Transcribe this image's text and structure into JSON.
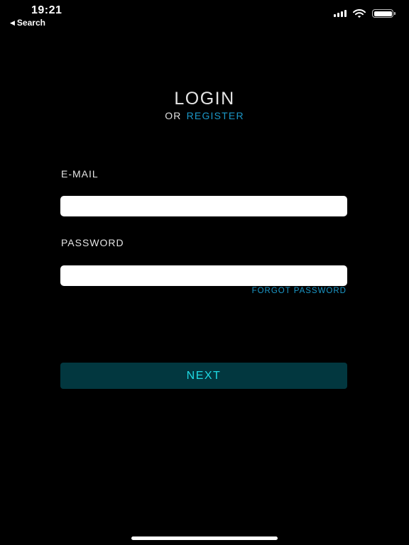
{
  "status_bar": {
    "time": "19:21",
    "back_label": "Search",
    "battery_level": 1.0,
    "signal_bars": 4,
    "icons": [
      "cellular-signal-icon",
      "wifi-icon",
      "battery-icon"
    ]
  },
  "header": {
    "title": "LOGIN",
    "or_text": "OR",
    "register_label": "REGISTER"
  },
  "form": {
    "email_label": "E-MAIL",
    "email_value": "",
    "password_label": "PASSWORD",
    "password_value": "",
    "forgot_label": "FORGOT PASSWORD",
    "next_label": "NEXT"
  },
  "colors": {
    "background": "#000000",
    "accent_link": "#1b97c7",
    "button_bg": "#02373f",
    "button_text": "#1fd9e3"
  }
}
